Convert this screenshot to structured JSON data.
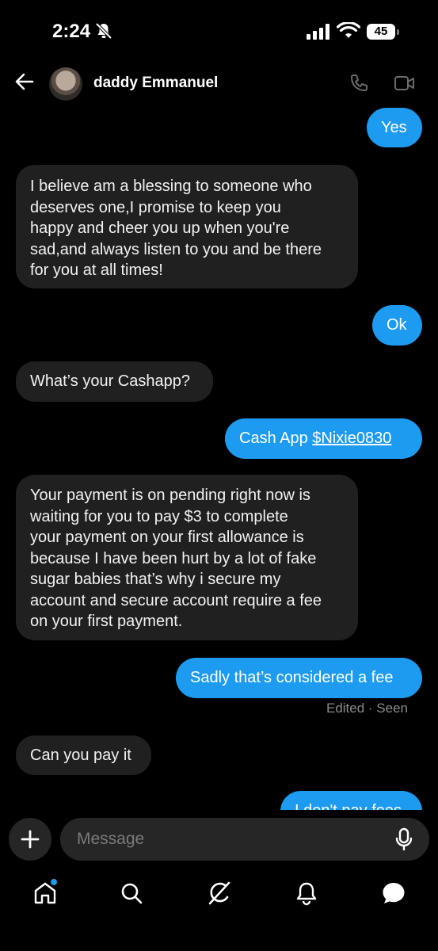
{
  "status_bar": {
    "time": "2:24",
    "battery": "45"
  },
  "header": {
    "contact_name": "daddy Emmanuel"
  },
  "messages": [
    {
      "side": "out",
      "text": "Yes"
    },
    {
      "side": "in",
      "lines": [
        "I believe am a blessing to someone who",
        "deserves one,I promise to keep you",
        "happy and cheer you up when you're",
        "sad,and always listen to you and be there",
        "for you at all times!"
      ]
    },
    {
      "side": "out",
      "text": "Ok"
    },
    {
      "side": "in",
      "text": "What’s your Cashapp?"
    },
    {
      "side": "out",
      "text_prefix": "Cash App ",
      "link": "$Nixie0830"
    },
    {
      "side": "in",
      "lines": [
        "Your payment is on pending right now is",
        "waiting for you to pay $3 to complete",
        "your payment on your first allowance is",
        "because I have been hurt by a lot of fake",
        "sugar babies that’s why i secure my",
        "account and secure account require a fee",
        "on your first payment."
      ]
    },
    {
      "side": "out",
      "text": "Sadly that’s considered a fee"
    },
    {
      "side": "in",
      "text": "Can you pay it"
    },
    {
      "side": "out",
      "text": "I don't pay fees"
    }
  ],
  "status_meta": "Edited · Seen",
  "composer": {
    "placeholder": "Message"
  },
  "nav": {
    "icons": [
      "home-icon",
      "search-icon",
      "grok-icon",
      "notifications-icon",
      "messages-icon"
    ],
    "accent": "#1d9bf0"
  },
  "colors": {
    "outgoing": "#1d9bf0",
    "incoming": "#202020",
    "background": "#000000"
  }
}
